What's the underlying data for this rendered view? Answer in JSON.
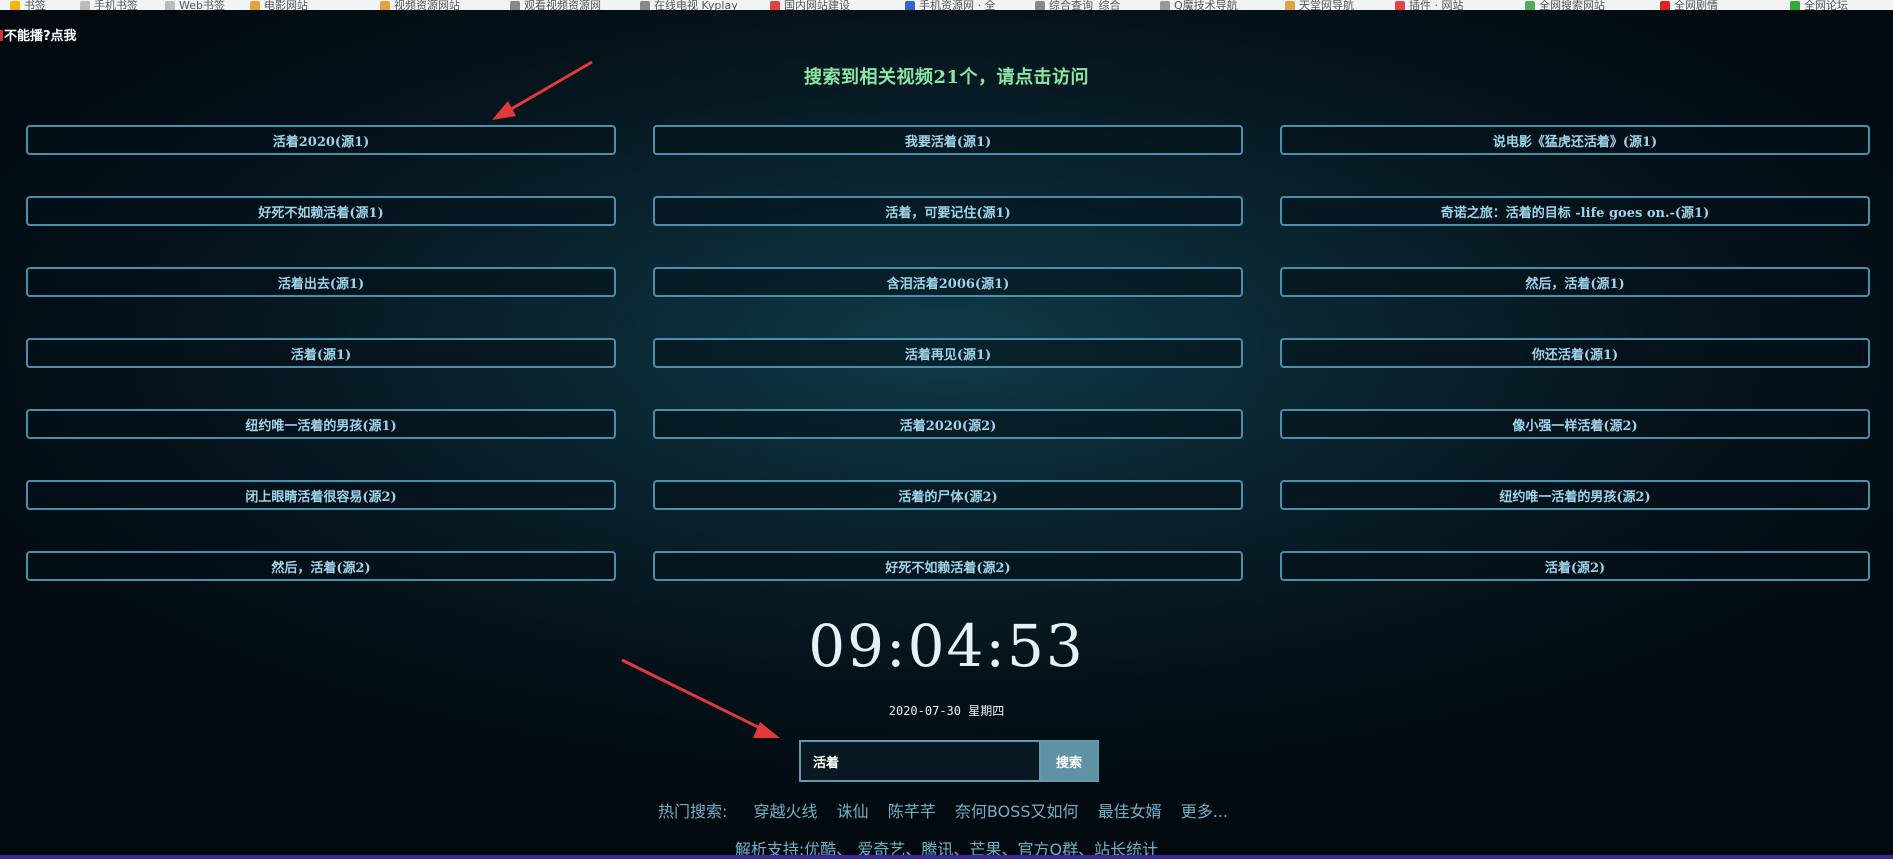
{
  "bookmarks": [
    "书签",
    "手机书签",
    "Web书签",
    "电影网站",
    "视频资源网站",
    "观看视频资源网",
    "在线电视 Kyplay",
    "国内网站建设",
    "手机资源网 · 全",
    "综合查询_综合",
    "Q魔技术导航",
    "天堂网导航",
    "插件 · 网站",
    "全网搜索网站",
    "全网剧情",
    "全网论坛"
  ],
  "notice": "不能播?点我",
  "result_title": "搜索到相关视频21个，请点击访问",
  "results": [
    "活着2020(源1)",
    "我要活着(源1)",
    "说电影《猛虎还活着》(源1)",
    "好死不如赖活着(源1)",
    "活着，可要记住(源1)",
    "奇诺之旅：活着的目标 -life goes on.-(源1)",
    "活着出去(源1)",
    "含泪活着2006(源1)",
    "然后，活着(源1)",
    "活着(源1)",
    "活着再见(源1)",
    "你还活着(源1)",
    "纽约唯一活着的男孩(源1)",
    "活着2020(源2)",
    "像小强一样活着(源2)",
    "闭上眼睛活着很容易(源2)",
    "活着的尸体(源2)",
    "纽约唯一活着的男孩(源2)",
    "然后，活着(源2)",
    "好死不如赖活着(源2)",
    "活着(源2)"
  ],
  "clock": "09:04:53",
  "date": "2020-07-30 星期四",
  "search": {
    "value": "活着",
    "button": "搜索"
  },
  "hot_search": {
    "label": "热门搜索:",
    "items": [
      "穿越火线",
      "诛仙",
      "陈芊芊",
      "奈何BOSS又如何",
      "最佳女婿",
      "更多..."
    ]
  },
  "support": {
    "label": "解析支持:",
    "items": [
      "优酷",
      "爱奇艺",
      "腾讯",
      "芒果",
      "官方Q群",
      "站长统计"
    ]
  }
}
